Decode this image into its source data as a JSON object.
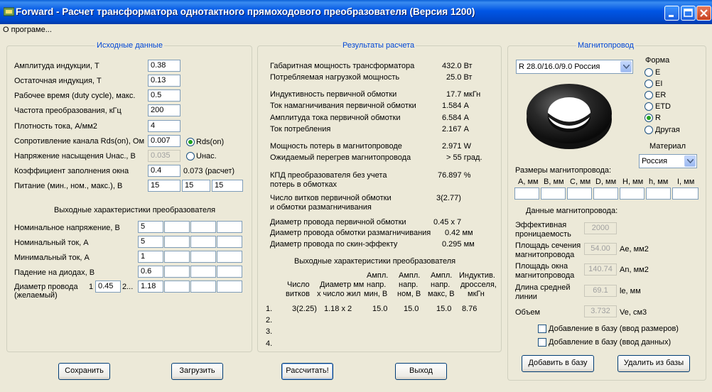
{
  "window": {
    "title": "Forward - Расчет трансформатора однотактного прямоходового преобразователя (Версия 1200)",
    "menu": "О програме..."
  },
  "input": {
    "group_title": "Исходные данные",
    "induction_amp": {
      "label": "Амплитуда индукции, Т",
      "value": "0.38"
    },
    "induction_res": {
      "label": "Остаточная индукция, Т",
      "value": "0.13"
    },
    "duty": {
      "label": "Рабочее время (duty cycle), макс.",
      "value": "0.5"
    },
    "freq": {
      "label": "Частота преобразования, кГц",
      "value": "200"
    },
    "current_density": {
      "label": "Плотность тока, А/мм2",
      "value": "4"
    },
    "rds": {
      "label": "Сопротивление канала Rds(on), Ом",
      "value": "0.007",
      "radio": "Rds(on)"
    },
    "usat": {
      "label": "Напряжение насыщения Uнас., В",
      "value": "0.035",
      "radio": "Uнас."
    },
    "fill": {
      "label": "Коэффициент заполнения окна",
      "value": "0.4",
      "calc": "0.073 (расчет)"
    },
    "supply": {
      "label": "Питание (мин., ном., макс.), В",
      "min": "15",
      "nom": "15",
      "max": "15"
    },
    "out_title": "Выходные характеристики преобразователя",
    "v_nom": {
      "label": "Номинальное напряжение, В",
      "value": "5"
    },
    "i_nom": {
      "label": "Номинальный ток, А",
      "value": "5"
    },
    "i_min": {
      "label": "Минимальный ток, А",
      "value": "1"
    },
    "v_diode": {
      "label": "Падение на диодах, В",
      "value": "0.6"
    },
    "wire": {
      "label_1": "Диаметр провода",
      "label_2": "(желаемый)",
      "n1": "1",
      "v1": "0.45",
      "n2": "2...",
      "v2": "1.18"
    }
  },
  "results": {
    "group_title": "Результаты расчета",
    "rows": [
      {
        "label": "Габаритная мощность трансформатора",
        "value": "432.0 Вт"
      },
      {
        "label": "Потребляемая нагрузкой мощность",
        "value": "25.0 Вт"
      },
      {
        "label": "Индуктивность первичной обмотки",
        "value": "17.7 мкГн"
      },
      {
        "label": "Ток намагничивания первичной обмотки",
        "value": "1.584 А"
      },
      {
        "label": "Амплитуда тока первичной обмотки",
        "value": "6.584 А"
      },
      {
        "label": "Ток потребления",
        "value": "2.167 А"
      },
      {
        "label": "Мощность потерь в магнитопроводе",
        "value": "2.971 W"
      },
      {
        "label": "Ожидаемый перегрев магнитопровода",
        "value": "> 55 град."
      },
      {
        "label": "КПД преобразователя без учета",
        "label_2": "потерь в обмотках",
        "value": "76.897 %"
      },
      {
        "label": "Число витков первичной обмотки",
        "label_2": "и обмотки размагничивания",
        "value": "3(2.77)"
      },
      {
        "label": "Диаметр провода первичной обмотки",
        "value": "0.45 x 7"
      },
      {
        "label": "Диаметр провода обмотки размагничивания",
        "value": "0.42 мм"
      },
      {
        "label": "Диаметр провода по скин-эффекту",
        "value": "0.295 мм"
      }
    ],
    "out_title": "Выходные характеристики преобразователя",
    "table": {
      "headers": [
        [
          "Число",
          "витков"
        ],
        [
          "Диаметр мм",
          "х число жил"
        ],
        [
          "Ампл.",
          "напр.",
          "мин, В"
        ],
        [
          "Ампл.",
          "напр.",
          "ном, В"
        ],
        [
          "Ампл.",
          "напр.",
          "макс, В"
        ],
        [
          "Индуктив.",
          "дросселя,",
          "мкГн"
        ]
      ],
      "row_numbers": [
        "1.",
        "2.",
        "3.",
        "4."
      ],
      "row1": [
        "3(2.25)",
        "1.18 x 2",
        "15.0",
        "15.0",
        "15.0",
        "8.76"
      ]
    }
  },
  "core": {
    "group_title": "Магнитопровод",
    "selected_core": "R 28.0/16.0/9.0 Россия",
    "shape_label": "Форма",
    "shapes": [
      "E",
      "EI",
      "ER",
      "ETD",
      "R",
      "Другая"
    ],
    "shape_selected": "R",
    "material_label": "Материал",
    "material": "Россия",
    "sizes_title": "Размеры магнитопровода:",
    "size_headers": [
      "A, мм",
      "B, мм",
      "C, мм",
      "D, мм",
      "H, мм",
      "h, мм",
      "I, мм"
    ],
    "data_title": "Данные магнитопровода:",
    "permeability": {
      "label_1": "Эффективная",
      "label_2": "проницаемость",
      "value": "2000"
    },
    "ae": {
      "label_1": "Площадь сечения",
      "label_2": "магнитопровода",
      "value": "54.00",
      "unit": "Ae, мм2"
    },
    "an": {
      "label_1": "Площадь окна",
      "label_2": "магнитопровода",
      "value": "140.74",
      "unit": "An, мм2"
    },
    "le": {
      "label_1": "Длина средней",
      "label_2": "линии",
      "value": "69.1",
      "unit": "le, мм"
    },
    "ve": {
      "label": "Объем",
      "value": "3.732",
      "unit": "Ve, см3"
    },
    "chk_sizes": "Добавление в базу (ввод размеров)",
    "chk_data": "Добавление в базу (ввод данных)",
    "add_btn": "Добавить в базу",
    "del_btn": "Удалить из базы"
  },
  "buttons": {
    "save": "Сохранить",
    "load": "Загрузить",
    "calc": "Рассчитать!",
    "exit": "Выход"
  },
  "colors": {
    "title_bar": "#0055e5",
    "group_title": "#0046d5",
    "face": "#ece9d8"
  }
}
